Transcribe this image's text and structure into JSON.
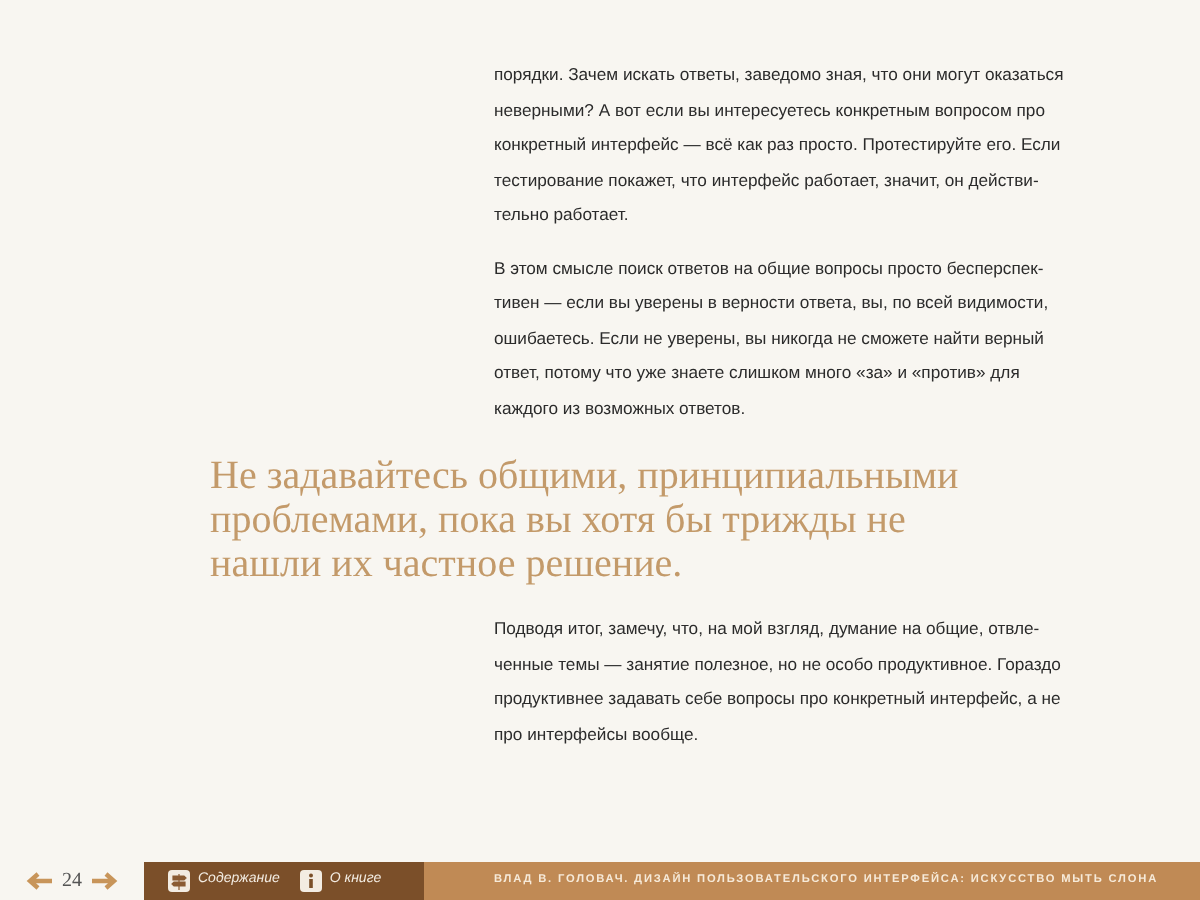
{
  "paragraphs_top": [
    "порядки. Зачем искать ответы, заведомо зная, что они могут оказаться\nневерными? А вот если вы интересуетесь конкретным вопросом про\nконкретный интерфейс — всё как раз просто. Протестируйте его. Если\nтестирование покажет, что интерфейс работает, значит, он действи-\nтельно работает.",
    "В этом смысле поиск ответов на общие вопросы просто бесперспек-\nтивен — если вы уверены в верности ответа, вы, по всей видимости,\nошибаетесь. Если не уверены, вы никогда не сможете найти верный\nответ, потому что уже знаете слишком много «за» и «против» для\nкаждого из возможных ответов."
  ],
  "pull_quote": "Не задавайтесь общими, принципиальными\nпроблемами, пока вы хотя бы трижды не\nнашли их частное решение.",
  "paragraphs_bottom": [
    "Подводя итог, замечу, что, на мой взгляд, думание на общие, отвле-\nченные темы — занятие полезное, но не особо продуктивное. Гораздо\nпродуктивнее задавать себе вопросы про конкретный интерфейс, а не\nпро интерфейсы вообще."
  ],
  "footer": {
    "page_number": "24",
    "links": [
      {
        "kind": "contents",
        "label": "Содержание"
      },
      {
        "kind": "about",
        "label": "О книге"
      }
    ],
    "book_title": "ВЛАД В. ГОЛОВАЧ. ДИЗАЙН ПОЛЬЗОВАТЕЛЬСКОГО ИНТЕРФЕЙСА: ИСКУССТВО МЫТЬ СЛОНА"
  }
}
